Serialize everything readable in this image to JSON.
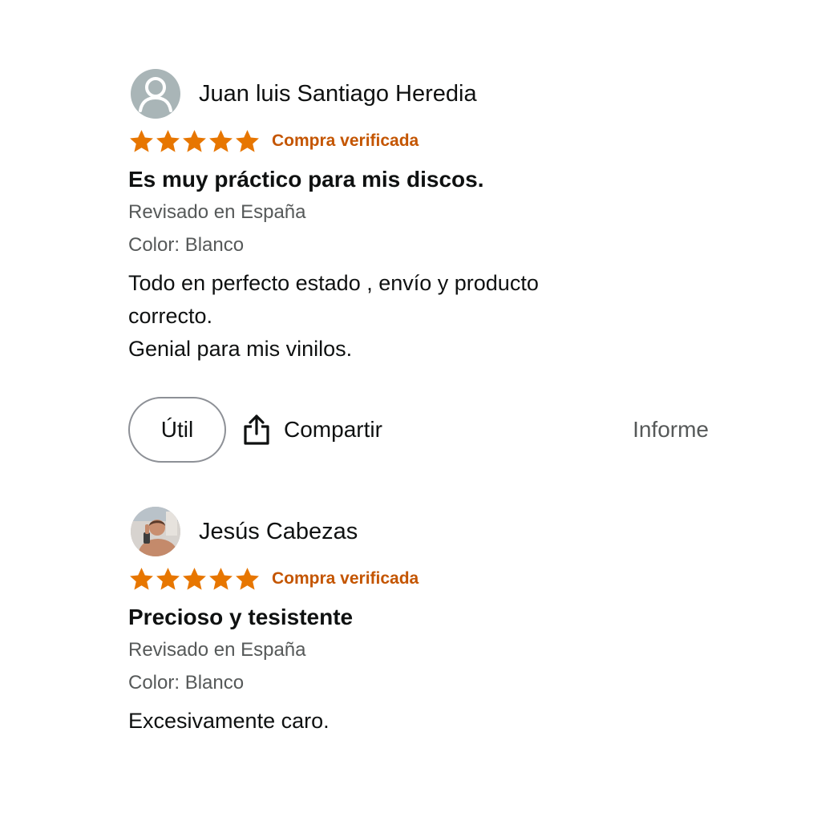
{
  "reviews": [
    {
      "author": "Juan luis Santiago Heredia",
      "avatar": "default-user-icon",
      "rating": 5,
      "verified_label": "Compra verificada",
      "title": "Es muy práctico para mis discos.",
      "reviewed_in": "Revisado en España",
      "variant": "Color: Blanco",
      "body_lines": [
        "Todo en perfecto estado , envío y producto",
        "correcto.",
        "Genial para mis vinilos."
      ]
    },
    {
      "author": "Jesús Cabezas",
      "avatar": "user-photo",
      "rating": 5,
      "verified_label": "Compra verificada",
      "title": "Precioso y tesistente",
      "reviewed_in": "Revisado en España",
      "variant": "Color: Blanco",
      "body_lines": [
        "Excesivamente caro."
      ]
    }
  ],
  "actions": {
    "helpful_label": "Útil",
    "share_label": "Compartir",
    "report_label": "Informe"
  },
  "colors": {
    "star": "#e77600",
    "verified": "#c45500",
    "meta": "#565959",
    "text": "#0f1111"
  }
}
